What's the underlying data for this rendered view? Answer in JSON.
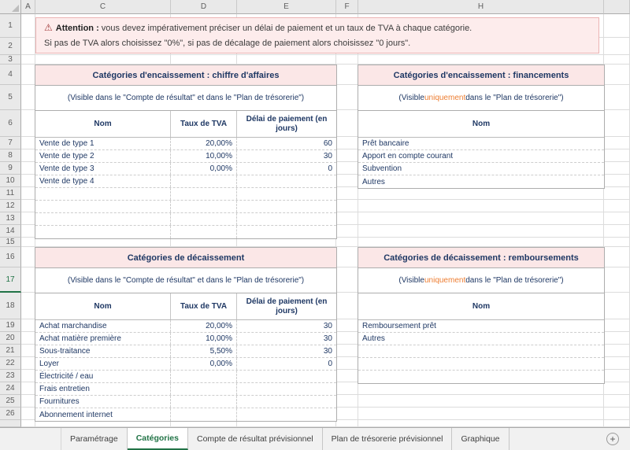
{
  "ui": {
    "column_headers": [
      "A",
      "C",
      "D",
      "E",
      "F",
      "H"
    ],
    "row_count": 26
  },
  "warning": {
    "icon": "⚠",
    "line1_bold": "Attention :",
    "line1_rest": " vous devez impérativement préciser un délai de paiement et un taux de TVA à chaque catégorie.",
    "line2": "Si pas de TVA alors choisissez \"0%\", si pas de décalage de paiement alors choisissez \"0 jours\"."
  },
  "tables": [
    {
      "id": "encaissement-chiffre-affaires",
      "title": "Catégories d'encaissement : chiffre d'affaires",
      "subtitle": [
        {
          "text": "(Visible dans le \"Compte de résultat\" et dans le \"Plan de trésorerie\")"
        }
      ],
      "columns": [
        "Nom",
        "Taux de TVA",
        "Délai de paiement (en jours)"
      ],
      "rows": [
        [
          "Vente de type 1",
          "20,00%",
          "60"
        ],
        [
          "Vente de type 2",
          "10,00%",
          "30"
        ],
        [
          "Vente de type 3",
          "0,00%",
          "0"
        ],
        [
          "Vente de type 4",
          "",
          ""
        ],
        [
          "",
          "",
          ""
        ],
        [
          "",
          "",
          ""
        ],
        [
          "",
          "",
          ""
        ],
        [
          "",
          "",
          ""
        ]
      ]
    },
    {
      "id": "encaissement-financements",
      "title": "Catégories d'encaissement : financements",
      "subtitle": [
        {
          "text": "(Visible "
        },
        {
          "text": "uniquement",
          "highlight": true
        },
        {
          "text": " dans le \"Plan de trésorerie\")"
        }
      ],
      "columns": [
        "Nom"
      ],
      "rows": [
        [
          "Prêt bancaire"
        ],
        [
          "Apport en compte courant"
        ],
        [
          "Subvention"
        ],
        [
          "Autres"
        ]
      ]
    },
    {
      "id": "decaissement",
      "title": "Catégories de décaissement",
      "subtitle": [
        {
          "text": "(Visible dans le \"Compte de résultat\" et dans le \"Plan de trésorerie\")"
        }
      ],
      "columns": [
        "Nom",
        "Taux de TVA",
        "Délai de paiement (en jours)"
      ],
      "rows": [
        [
          "Achat marchandise",
          "20,00%",
          "30"
        ],
        [
          "Achat matière première",
          "10,00%",
          "30"
        ],
        [
          "Sous-traitance",
          "5,50%",
          "30"
        ],
        [
          "Loyer",
          "0,00%",
          "0"
        ],
        [
          "Électricité / eau",
          "",
          ""
        ],
        [
          "Frais entretien",
          "",
          ""
        ],
        [
          "Fournitures",
          "",
          ""
        ],
        [
          "Abonnement internet",
          "",
          ""
        ]
      ]
    },
    {
      "id": "decaissement-remboursements",
      "title": "Catégories de décaissement : remboursements",
      "subtitle": [
        {
          "text": "(Visible "
        },
        {
          "text": "uniquement",
          "highlight": true
        },
        {
          "text": " dans le \"Plan de trésorerie\")"
        }
      ],
      "columns": [
        "Nom"
      ],
      "rows": [
        [
          "Remboursement prêt"
        ],
        [
          "Autres"
        ],
        [
          ""
        ],
        [
          ""
        ],
        [
          ""
        ]
      ]
    }
  ],
  "sheet_tabs": {
    "tabs": [
      {
        "label": "Paramétrage",
        "active": false
      },
      {
        "label": "Catégories",
        "active": true
      },
      {
        "label": "Compte de résultat prévisionnel",
        "active": false
      },
      {
        "label": "Plan de trésorerie prévisionnel",
        "active": false
      },
      {
        "label": "Graphique",
        "active": false
      }
    ],
    "add_label": "+"
  },
  "colors": {
    "accent_green": "#217346",
    "navy_text": "#1F3864",
    "orange_highlight": "#ED7D31",
    "table_title_bg": "#FBE7E7",
    "warning_bg": "#FDECEC",
    "warning_border": "#EBB3B3",
    "gridline": "#DCDCDC"
  }
}
